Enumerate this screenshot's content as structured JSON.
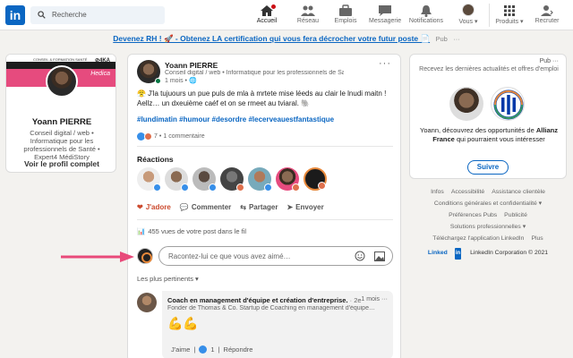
{
  "nav": {
    "logo": "in",
    "search_placeholder": "Recherche",
    "items": [
      {
        "label": "Accueil"
      },
      {
        "label": "Réseau"
      },
      {
        "label": "Emplois"
      },
      {
        "label": "Messagerie"
      },
      {
        "label": "Notifications"
      },
      {
        "label": "Vous"
      },
      {
        "label": "Produits"
      },
      {
        "label": "Recruter"
      }
    ]
  },
  "banner": {
    "text": "Devenez RH ! 🚀 - Obtenez LA certification qui vous fera décrocher votre futur poste 📄",
    "pub": "Pub",
    "more": "···"
  },
  "profile": {
    "cover_brand": "Hedica",
    "cover_top": "CONSEIL & FORMATION SANTÉ",
    "cover_logo": "⊘4KA",
    "name": "Yoann PIERRE",
    "headline": "Conseil digital / web • Informatique pour les professionnels de Santé • Expert4 MédiStory",
    "view_profile": "Voir le profil complet"
  },
  "post": {
    "author": "Yoann PIERRE",
    "headline": "Conseil digital / web • Informatique pour les professionnels de Santé…",
    "time": "1 mois • ",
    "more": "···",
    "text": "😤 J'la tujuours un pue puls de mla à mrtete mise léeds au clair le lnudi maitn ! Aellz… un dxeuième caéf et on se rmeet au tviaral. 🐘",
    "hashtags": "#lundimatin #humour #desordre #lecerveauestfantastique",
    "reaction_count": "7",
    "comment_count": "1 commentaire",
    "reactions_title": "Réactions",
    "actions": {
      "like": "J'adore",
      "comment": "Commenter",
      "share": "Partager",
      "send": "Envoyer"
    },
    "views": "455 vues de votre post dans le fil",
    "comment_placeholder": "Racontez-lui ce que vous avez aimé…",
    "sort": "Les plus pertinents ▾"
  },
  "comment": {
    "author": "Coach en management d'équipe et création d'entreprise.",
    "degree": "· 2e",
    "time": "1 mois",
    "more": "···",
    "headline": "Fonder de Thomas & Co. Startup de Coaching en management d'équipe…",
    "emoji": "💪💪",
    "like": "J'aime",
    "like_count": "1",
    "reply": "Répondre"
  },
  "ad": {
    "pub": "Pub",
    "more": "···",
    "subtitle": "Recevez les dernières actualités et offres d'emploi",
    "text_a": "Yoann, découvrez des opportunités de ",
    "brand": "Allianz France",
    "text_b": " qui pourraient vous intéresser",
    "button": "Suivre"
  },
  "footer": {
    "links": [
      "Infos",
      "Accessibilité",
      "Assistance clientèle",
      "Conditions générales et confidentialité ▾",
      "Préférences Pubs",
      "Publicité",
      "Solutions professionnelles ▾",
      "Téléchargez l'application LinkedIn",
      "Plus"
    ],
    "brand_word": "Linked",
    "brand_in": "in",
    "copyright": "LinkedIn Corporation © 2021"
  },
  "colors": {
    "brand_blue": "#0a66c2",
    "arrow": "#e84a7a",
    "reaction_orange": "#cc4b2f"
  }
}
